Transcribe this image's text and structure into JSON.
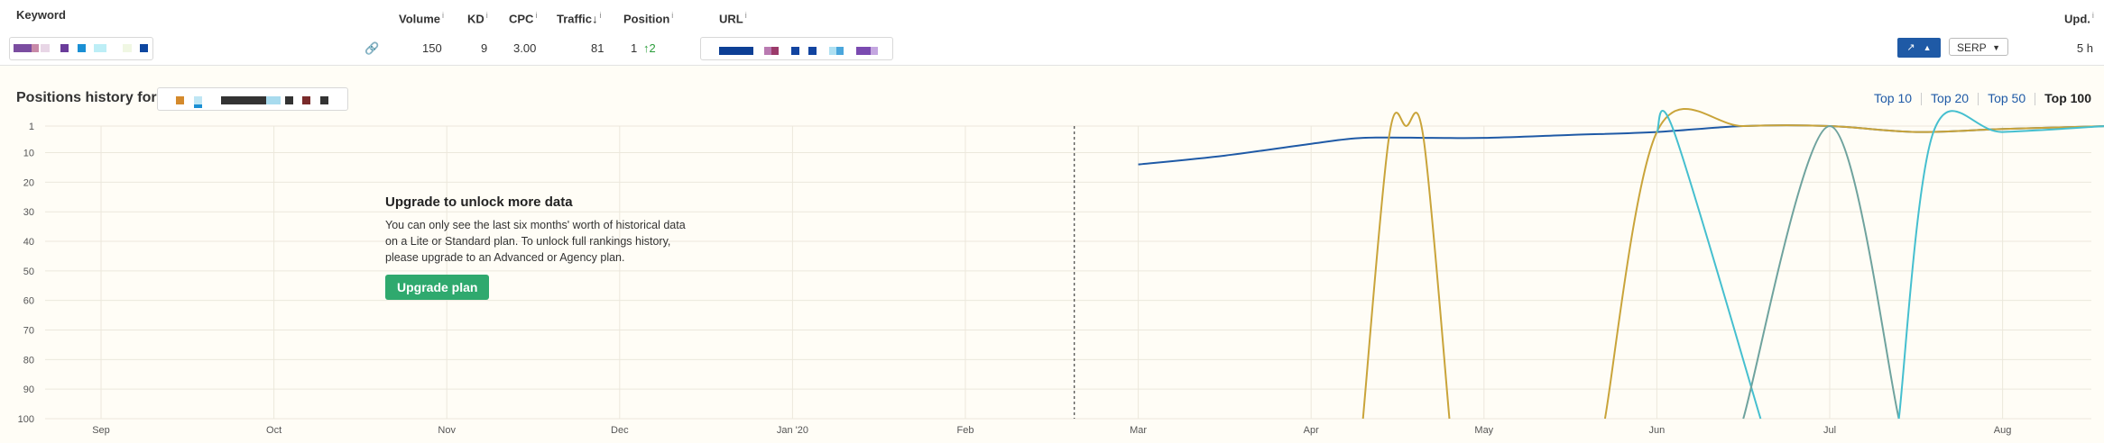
{
  "header": {
    "keyword": "Keyword",
    "volume": "Volume",
    "kd": "KD",
    "cpc": "CPC",
    "traffic": "Traffic",
    "traffic_sort_icon": "arrow-down",
    "position": "Position",
    "url": "URL",
    "updated": "Upd.",
    "info_mark": "i"
  },
  "row": {
    "volume": "150",
    "kd": "9",
    "cpc": "3.00",
    "traffic": "81",
    "position": "1",
    "position_change": "↑2",
    "serp_label": "SERP",
    "updated": "5 h"
  },
  "history": {
    "title": "Positions history for",
    "top_links": [
      {
        "label": "Top 10",
        "active": false
      },
      {
        "label": "Top 20",
        "active": false
      },
      {
        "label": "Top 50",
        "active": false
      },
      {
        "label": "Top 100",
        "active": true
      }
    ]
  },
  "upsell": {
    "title": "Upgrade to unlock more data",
    "body": "You can only see the last six months' worth of historical data on a Lite or Standard plan. To unlock full rankings history, please upgrade to an Advanced or Agency plan.",
    "button": "Upgrade plan"
  },
  "colors": {
    "series_main": "#1f5aa6",
    "series_gold": "#c9a43a",
    "series_cyan": "#45bfcf",
    "series_grey": "#6fa39e",
    "upgrade_button": "#2fa96e",
    "link_blue": "#1f5aa6"
  },
  "chart_data": {
    "type": "line",
    "y_ticks": [
      "1",
      "10",
      "20",
      "30",
      "40",
      "50",
      "60",
      "70",
      "80",
      "90",
      "100"
    ],
    "ylim": [
      1,
      100
    ],
    "y_inverted": true,
    "x_labels": [
      "Sep",
      "Oct",
      "Nov",
      "Dec",
      "Jan '20",
      "Feb",
      "Mar",
      "Apr",
      "May",
      "Jun",
      "Jul",
      "Aug"
    ],
    "grid": true,
    "cutoff_marker_between": [
      "Feb",
      "Mar"
    ],
    "series": [
      {
        "color": "#1f5aa6",
        "points": [
          [
            6.0,
            14
          ],
          [
            6.5,
            11
          ],
          [
            7.0,
            7
          ],
          [
            7.3,
            5
          ],
          [
            7.7,
            5
          ],
          [
            8.0,
            5
          ],
          [
            8.5,
            4
          ],
          [
            9.0,
            3
          ],
          [
            9.5,
            1
          ],
          [
            10.0,
            1
          ],
          [
            10.5,
            3
          ],
          [
            11.0,
            2
          ],
          [
            11.6,
            1
          ]
        ]
      },
      {
        "color": "#c9a43a",
        "points": [
          [
            7.3,
            100
          ],
          [
            7.45,
            5
          ],
          [
            7.55,
            1
          ],
          [
            7.65,
            5
          ],
          [
            7.8,
            100
          ]
        ]
      },
      {
        "color": "#c9a43a",
        "points": [
          [
            8.7,
            100
          ],
          [
            9.0,
            3
          ],
          [
            9.5,
            1
          ],
          [
            10.0,
            1
          ],
          [
            10.5,
            3
          ],
          [
            11.0,
            2
          ],
          [
            11.6,
            1
          ]
        ]
      },
      {
        "color": "#45bfcf",
        "points": [
          [
            9.0,
            3
          ],
          [
            9.1,
            3
          ],
          [
            9.6,
            100
          ]
        ]
      },
      {
        "color": "#6fa39e",
        "points": [
          [
            9.5,
            100
          ],
          [
            10.0,
            1
          ],
          [
            10.4,
            100
          ]
        ]
      },
      {
        "color": "#45bfcf",
        "points": [
          [
            10.4,
            100
          ],
          [
            10.6,
            3
          ],
          [
            11.0,
            3
          ],
          [
            11.6,
            1
          ]
        ]
      }
    ]
  }
}
